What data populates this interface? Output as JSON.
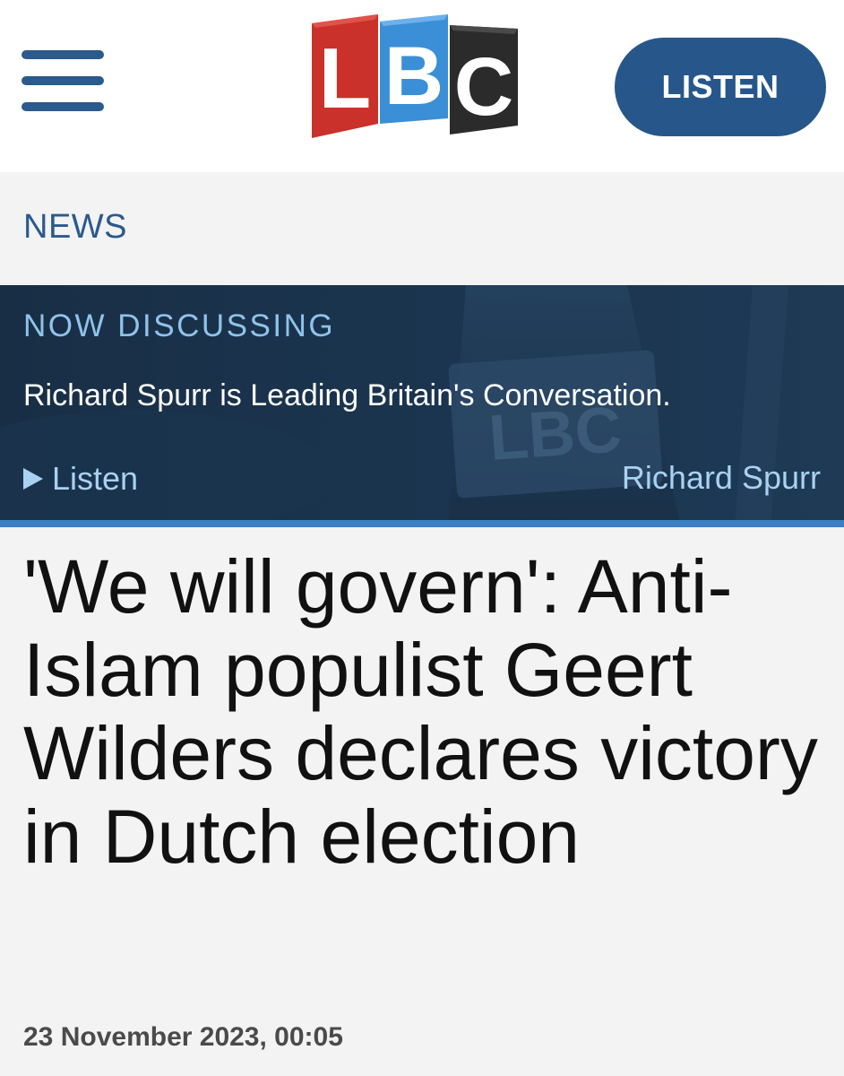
{
  "header": {
    "logo_letters": [
      "L",
      "B",
      "C"
    ],
    "listen_label": "LISTEN",
    "colors": {
      "brand_blue": "#27578a",
      "logo_red": "#c9312a",
      "logo_blue": "#3a8fd6",
      "logo_dark": "#2b2b2b"
    }
  },
  "icons": {
    "menu": "hamburger-icon",
    "play": "play-icon"
  },
  "section": {
    "label": "NEWS"
  },
  "now_discussing": {
    "title": "NOW DISCUSSING",
    "description": "Richard Spurr is Leading Britain's Conversation.",
    "listen_label": "Listen",
    "presenter": "Richard Spurr",
    "background_mic_text": "LBC"
  },
  "article": {
    "headline": "'We will govern': Anti-Islam populist Geert Wilders declares victory in Dutch election",
    "date": "23 November 2023, 00:05"
  }
}
